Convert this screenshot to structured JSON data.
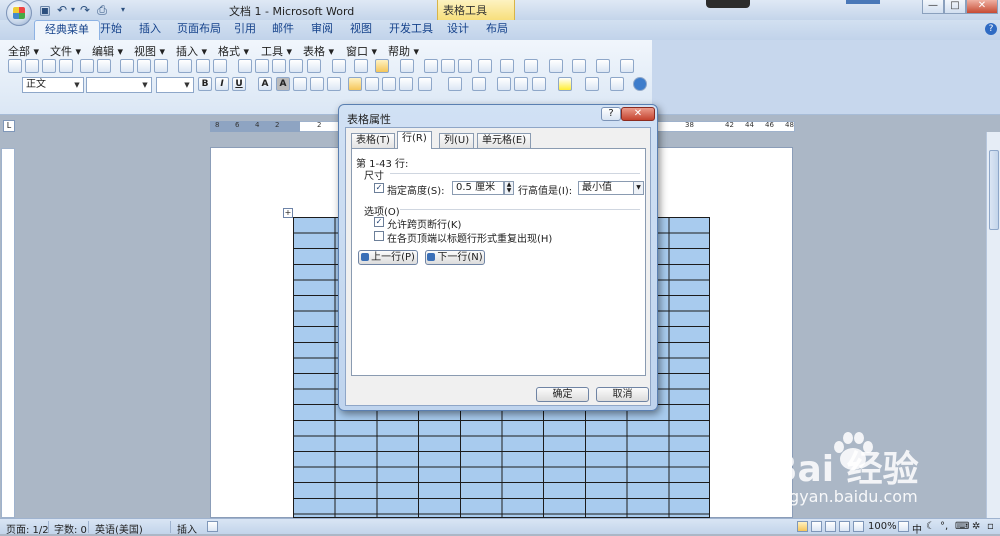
{
  "window": {
    "title": "文档 1 - Microsoft Word",
    "context_tab": "表格工具",
    "controls": [
      "—",
      "□",
      "✕"
    ]
  },
  "ribbon_tabs": [
    {
      "label": "经典菜单",
      "active": true
    },
    {
      "label": "开始"
    },
    {
      "label": "插入"
    },
    {
      "label": "页面布局"
    },
    {
      "label": "引用"
    },
    {
      "label": "邮件"
    },
    {
      "label": "审阅"
    },
    {
      "label": "视图"
    },
    {
      "label": "开发工具"
    },
    {
      "label": "设计"
    },
    {
      "label": "布局"
    }
  ],
  "classic_menu": [
    "全部 ▾",
    "文件 ▾",
    "编辑 ▾",
    "视图 ▾",
    "插入 ▾",
    "格式 ▾",
    "工具 ▾",
    "表格 ▾",
    "窗口 ▾",
    "帮助 ▾"
  ],
  "format_bar": {
    "style_value": "正文",
    "bold": "B",
    "italic": "I",
    "underline": "U",
    "char_border": "A",
    "char_shading": "A"
  },
  "ruler": {
    "h_numbers": [
      "8",
      "6",
      "4",
      "2",
      "2",
      "38",
      "42",
      "44",
      "46",
      "48"
    ],
    "corner_symbol": "L"
  },
  "dialog": {
    "title": "表格属性",
    "help_symbol": "?",
    "close_symbol": "✕",
    "tabs": [
      {
        "label": "表格(T)"
      },
      {
        "label": "行(R)",
        "active": true
      },
      {
        "label": "列(U)"
      },
      {
        "label": "单元格(E)"
      }
    ],
    "rows_label": "第 1-43 行:",
    "size_heading": "尺寸",
    "specify_height": {
      "label": "指定高度(S):",
      "checked": true
    },
    "height_value": "0.5 厘米",
    "row_height_is_label": "行高值是(I):",
    "row_height_rule": "最小值",
    "options_heading": "选项(O)",
    "allow_break": {
      "label": "允许跨页断行(K)",
      "checked": true
    },
    "repeat_header": {
      "label": "在各页顶端以标题行形式重复出现(H)",
      "checked": false
    },
    "prev_row": "上一行(P)",
    "next_row": "下一行(N)",
    "ok": "确定",
    "cancel": "取消"
  },
  "statusbar": {
    "page": "页面: 1/2",
    "words": "字数: 0",
    "language": "英语(美国)",
    "insert_mode": "插入",
    "zoom": "100%",
    "ime_label": "中"
  },
  "watermark": {
    "brand": "Bai  经验",
    "url": "jingyan.baidu.com"
  },
  "colors": {
    "table_fill": "#a8cbee",
    "ribbon_bg": "#dbe7f5",
    "context_tab": "#f7df7c"
  }
}
